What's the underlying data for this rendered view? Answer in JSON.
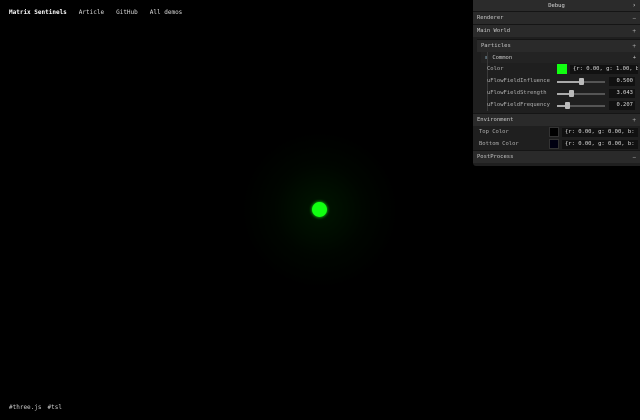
{
  "nav": {
    "brand": "Matrix Sentinels",
    "links": [
      "Article",
      "GitHub",
      "All demos"
    ]
  },
  "tags": [
    "#three.js",
    "#tsl"
  ],
  "scene": {
    "orb_color": "#11ff11"
  },
  "panel": {
    "title": "Debug",
    "folders": {
      "renderer": "Renderer",
      "main_world": "Main World",
      "particles": "Particles",
      "common": "Common",
      "environment": "Environment",
      "postprocess": "PostProcess"
    },
    "common_rows": {
      "color": {
        "label": "Color",
        "swatch": "#11ff11",
        "value": "{r: 0.00, g: 1.00, b: 0.00}"
      },
      "influence": {
        "label": "uFlowFieldInfluence",
        "value": "0.500",
        "fraction": 0.5
      },
      "strength": {
        "label": "uFlowFieldStrength",
        "value": "3.043",
        "fraction": 0.3
      },
      "frequency": {
        "label": "uFlowFieldFrequency",
        "value": "0.207",
        "fraction": 0.2
      }
    },
    "environment_rows": {
      "top": {
        "label": "Top Color",
        "swatch": "#000000",
        "value": "{r: 0.00, g: 0.00, b: 0.00}"
      },
      "bottom": {
        "label": "Bottom Color",
        "swatch": "#000011",
        "value": "{r: 0.00, g: 0.00, b: 0.02}"
      }
    }
  }
}
